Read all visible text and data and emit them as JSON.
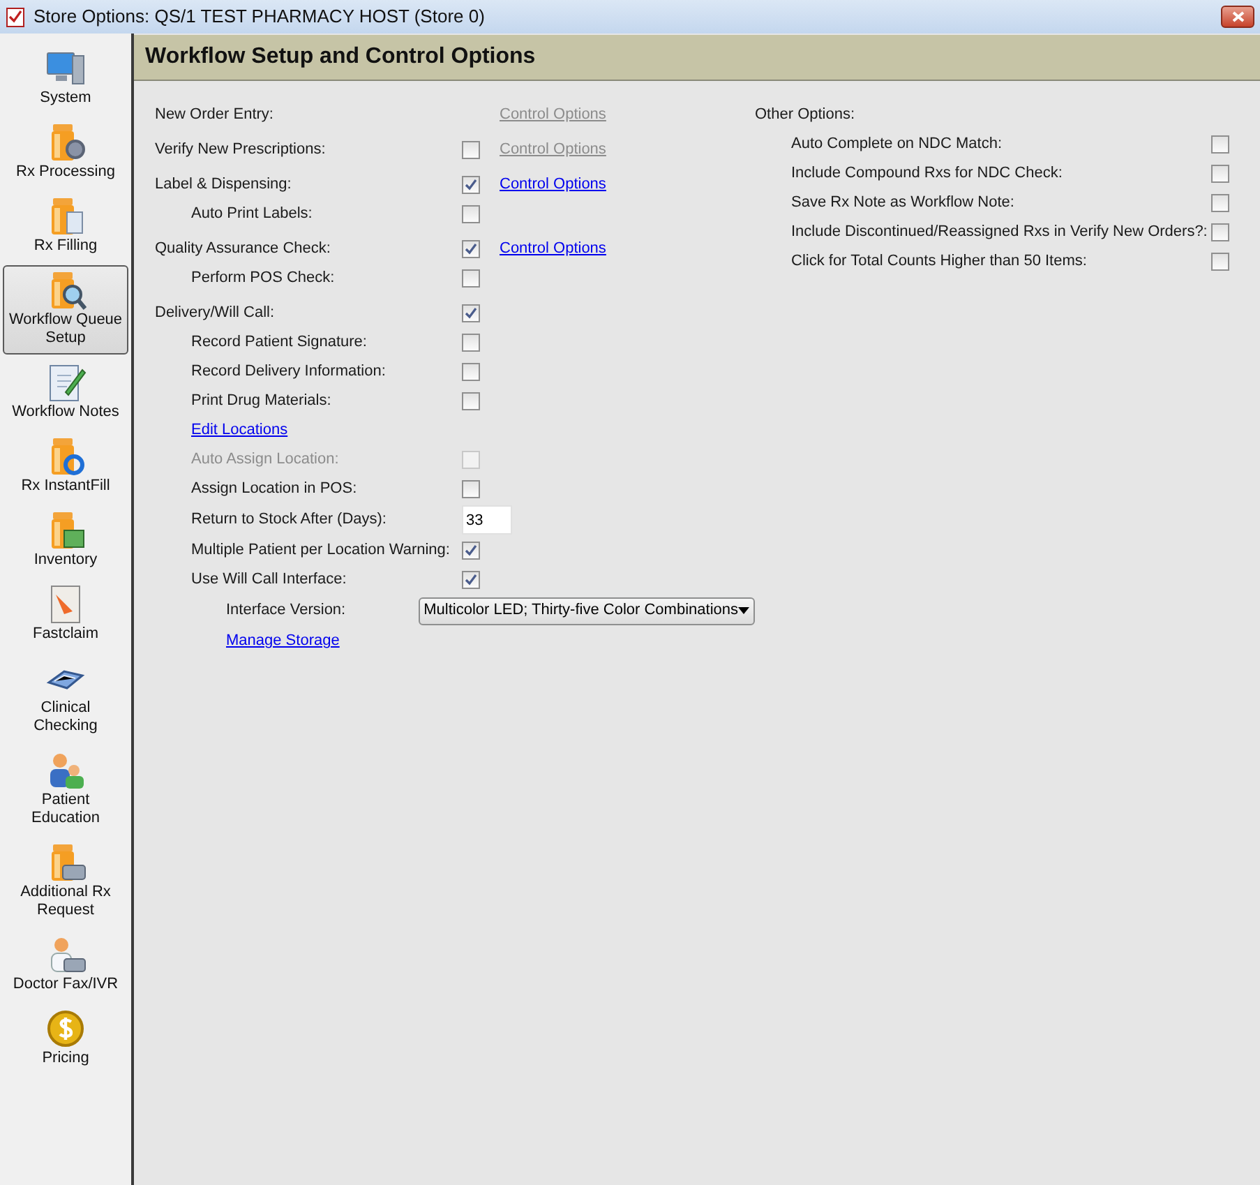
{
  "window": {
    "title": "Store Options: QS/1 TEST PHARMACY HOST (Store 0)"
  },
  "sidebar": {
    "items": [
      {
        "label": "System",
        "selected": false
      },
      {
        "label": "Rx Processing",
        "selected": false
      },
      {
        "label": "Rx Filling",
        "selected": false
      },
      {
        "label": "Workflow Queue Setup",
        "selected": true
      },
      {
        "label": "Workflow Notes",
        "selected": false
      },
      {
        "label": "Rx InstantFill",
        "selected": false
      },
      {
        "label": "Inventory",
        "selected": false
      },
      {
        "label": "Fastclaim",
        "selected": false
      },
      {
        "label": "Clinical Checking",
        "selected": false
      },
      {
        "label": "Patient Education",
        "selected": false
      },
      {
        "label": "Additional Rx Request",
        "selected": false
      },
      {
        "label": "Doctor Fax/IVR",
        "selected": false
      },
      {
        "label": "Pricing",
        "selected": false
      }
    ]
  },
  "header": {
    "title": "Workflow Setup and Control Options"
  },
  "workflow_options": [
    {
      "kind": "label",
      "label": "New Order Entry:",
      "link": {
        "text": "Control Options",
        "disabled": true
      }
    },
    {
      "kind": "checkbox",
      "label": "Verify New Prescriptions:",
      "checked": false,
      "disabled": false,
      "link": {
        "text": "Control Options",
        "disabled": true
      }
    },
    {
      "kind": "checkbox",
      "label": "Label & Dispensing:",
      "checked": true,
      "disabled": false,
      "link": {
        "text": "Control Options",
        "disabled": false
      },
      "children": [
        {
          "kind": "checkbox",
          "label": "Auto Print Labels:",
          "checked": false,
          "disabled": false
        }
      ]
    },
    {
      "kind": "checkbox",
      "label": "Quality Assurance Check:",
      "checked": true,
      "disabled": false,
      "link": {
        "text": "Control Options",
        "disabled": false
      },
      "children": [
        {
          "kind": "checkbox",
          "label": "Perform POS Check:",
          "checked": false,
          "disabled": false
        }
      ]
    },
    {
      "kind": "checkbox",
      "label": "Delivery/Will Call:",
      "checked": true,
      "disabled": false,
      "children": [
        {
          "kind": "checkbox",
          "label": "Record Patient Signature:",
          "checked": false,
          "disabled": false
        },
        {
          "kind": "checkbox",
          "label": "Record Delivery Information:",
          "checked": false,
          "disabled": false
        },
        {
          "kind": "checkbox",
          "label": "Print Drug Materials:",
          "checked": false,
          "disabled": false
        },
        {
          "kind": "link",
          "label": "Edit Locations"
        },
        {
          "kind": "checkbox",
          "label": "Auto Assign Location:",
          "checked": false,
          "disabled": true
        },
        {
          "kind": "checkbox",
          "label": "Assign Location in POS:",
          "checked": false,
          "disabled": false
        },
        {
          "kind": "input",
          "label": "Return to Stock After (Days):",
          "value": "33"
        },
        {
          "kind": "checkbox",
          "label": "Multiple Patient per Location Warning:",
          "checked": true,
          "disabled": false
        },
        {
          "kind": "checkbox",
          "label": "Use Will Call Interface:",
          "checked": true,
          "disabled": false,
          "children": [
            {
              "kind": "select",
              "label": "Interface Version:",
              "value": "Multicolor LED; Thirty-five Color Combinations"
            },
            {
              "kind": "link",
              "label": "Manage Storage"
            }
          ]
        }
      ]
    }
  ],
  "other_options": {
    "title": "Other Options:",
    "items": [
      {
        "label": "Auto Complete on NDC Match:",
        "checked": false
      },
      {
        "label": "Include Compound Rxs for NDC Check:",
        "checked": false
      },
      {
        "label": "Save Rx Note as Workflow Note:",
        "checked": false
      },
      {
        "label": "Include Discontinued/Reassigned Rxs in Verify New Orders?:",
        "checked": false
      },
      {
        "label": "Click for Total Counts Higher than 50 Items:",
        "checked": false
      }
    ]
  }
}
